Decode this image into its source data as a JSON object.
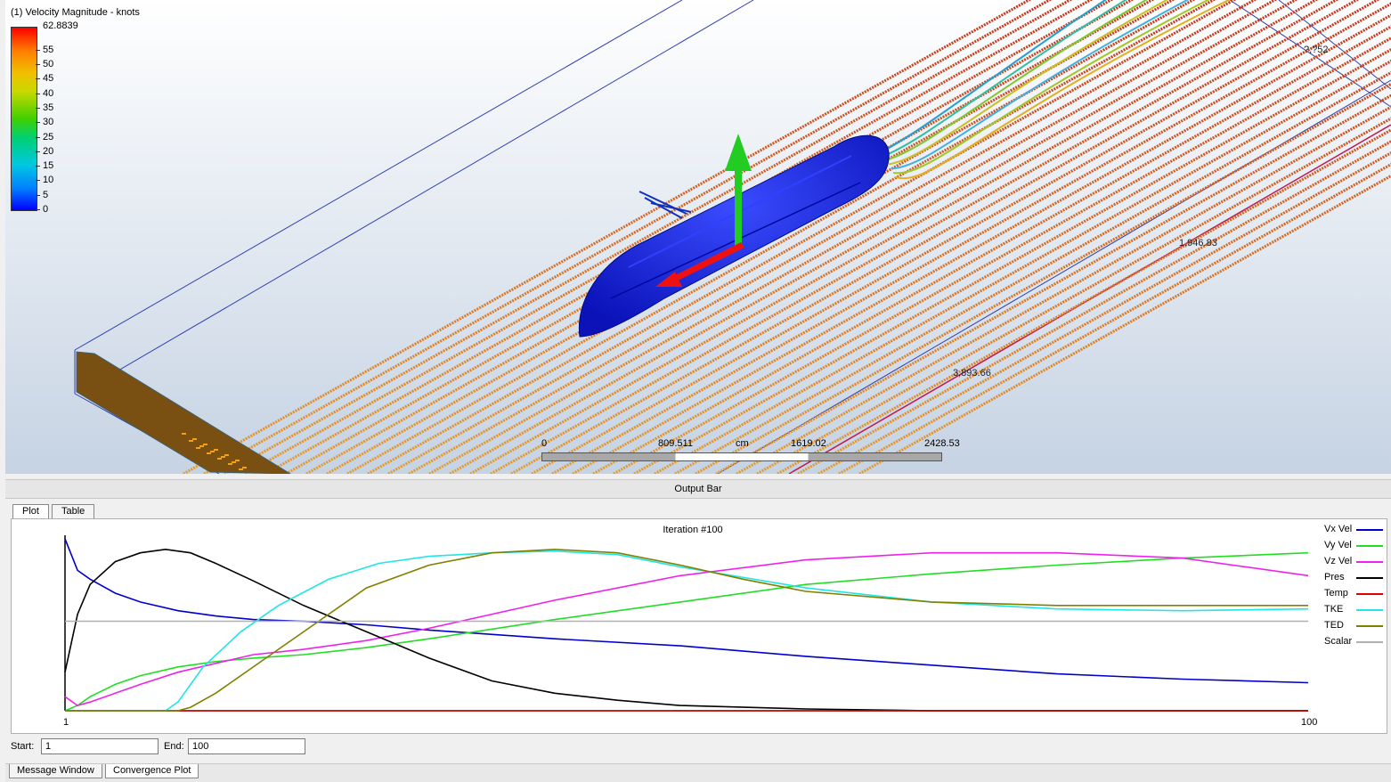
{
  "viewport": {
    "legend": {
      "title": "(1) Velocity Magnitude - knots",
      "max_label": "62.8839",
      "ticks": [
        "55",
        "50",
        "45",
        "40",
        "35",
        "30",
        "25",
        "20",
        "15",
        "10",
        "5",
        "0"
      ],
      "tick_values": [
        55,
        50,
        45,
        40,
        35,
        30,
        25,
        20,
        15,
        10,
        5,
        0
      ],
      "max_value": 62.8839
    },
    "scalebar": {
      "labels": [
        "0",
        "809.511",
        "cm",
        "1619.02",
        "2428.53"
      ]
    },
    "dimensions": [
      "3,893.66",
      "1,946.83",
      "?,?52"
    ],
    "colors": {
      "background_top": "#ffffff",
      "background_bottom": "#c6d3e3",
      "hull": "#1020e0",
      "arrow_up": "#22cc22",
      "arrow_flow": "#ee1111",
      "inlet": "#7a5012"
    }
  },
  "output_bar": {
    "title": "Output Bar"
  },
  "plot_panel": {
    "tabs": [
      "Plot",
      "Table"
    ],
    "active_tab": "Plot",
    "range": {
      "start_label": "Start:",
      "start_value": "1",
      "end_label": "End:",
      "end_value": "100"
    }
  },
  "bottom_tabs": [
    "Message Window",
    "Convergence Plot"
  ],
  "chart_data": {
    "type": "line",
    "title": "Iteration #100",
    "x_tick_labels": [
      "1",
      "100"
    ],
    "xlim": [
      1,
      100
    ],
    "ylim": [
      0,
      1
    ],
    "series": [
      {
        "name": "Vx Vel",
        "color": "#0000cc",
        "x": [
          1,
          2,
          3,
          5,
          7,
          10,
          13,
          16,
          20,
          25,
          30,
          40,
          50,
          60,
          70,
          80,
          90,
          100
        ],
        "y": [
          0.98,
          0.8,
          0.75,
          0.67,
          0.62,
          0.57,
          0.54,
          0.52,
          0.51,
          0.49,
          0.46,
          0.41,
          0.37,
          0.31,
          0.26,
          0.21,
          0.18,
          0.16
        ]
      },
      {
        "name": "Vy Vel",
        "color": "#22dd22",
        "x": [
          1,
          2,
          3,
          5,
          7,
          10,
          13,
          16,
          20,
          25,
          30,
          40,
          50,
          60,
          70,
          80,
          90,
          100
        ],
        "y": [
          0.0,
          0.03,
          0.08,
          0.15,
          0.2,
          0.25,
          0.28,
          0.3,
          0.32,
          0.36,
          0.41,
          0.52,
          0.62,
          0.72,
          0.78,
          0.83,
          0.87,
          0.9
        ]
      },
      {
        "name": "Vz Vel",
        "color": "#ee22ee",
        "x": [
          1,
          2,
          3,
          5,
          7,
          10,
          13,
          16,
          20,
          25,
          30,
          40,
          50,
          60,
          70,
          80,
          90,
          100
        ],
        "y": [
          0.08,
          0.03,
          0.05,
          0.1,
          0.15,
          0.22,
          0.27,
          0.32,
          0.35,
          0.4,
          0.47,
          0.63,
          0.77,
          0.86,
          0.9,
          0.9,
          0.87,
          0.77
        ]
      },
      {
        "name": "Pres",
        "color": "#000000",
        "x": [
          1,
          2,
          3,
          5,
          7,
          9,
          11,
          13,
          16,
          20,
          25,
          30,
          35,
          40,
          45,
          50,
          60,
          70,
          80,
          90,
          100
        ],
        "y": [
          0.22,
          0.55,
          0.72,
          0.85,
          0.9,
          0.92,
          0.9,
          0.84,
          0.74,
          0.6,
          0.45,
          0.3,
          0.17,
          0.1,
          0.06,
          0.03,
          0.01,
          0.0,
          0.0,
          0.0,
          0.0
        ]
      },
      {
        "name": "Temp",
        "color": "#dd0000",
        "x": [
          1,
          100
        ],
        "y": [
          0,
          0
        ]
      },
      {
        "name": "TKE",
        "color": "#22e5e5",
        "x": [
          1,
          9,
          10,
          12,
          15,
          18,
          22,
          26,
          30,
          35,
          40,
          45,
          50,
          60,
          70,
          80,
          90,
          100
        ],
        "y": [
          0.0,
          0.0,
          0.05,
          0.25,
          0.45,
          0.6,
          0.75,
          0.84,
          0.88,
          0.9,
          0.91,
          0.89,
          0.82,
          0.7,
          0.62,
          0.58,
          0.57,
          0.58
        ]
      },
      {
        "name": "TED",
        "color": "#808000",
        "x": [
          1,
          10,
          11,
          13,
          17,
          21,
          25,
          30,
          35,
          40,
          45,
          50,
          55,
          60,
          70,
          80,
          90,
          100
        ],
        "y": [
          0.0,
          0.0,
          0.02,
          0.1,
          0.3,
          0.5,
          0.7,
          0.83,
          0.9,
          0.92,
          0.9,
          0.83,
          0.75,
          0.68,
          0.62,
          0.6,
          0.6,
          0.6
        ]
      },
      {
        "name": "Scalar",
        "color": "#b0b0b0",
        "x": [
          1,
          100
        ],
        "y": [
          0.51,
          0.51
        ]
      }
    ]
  }
}
